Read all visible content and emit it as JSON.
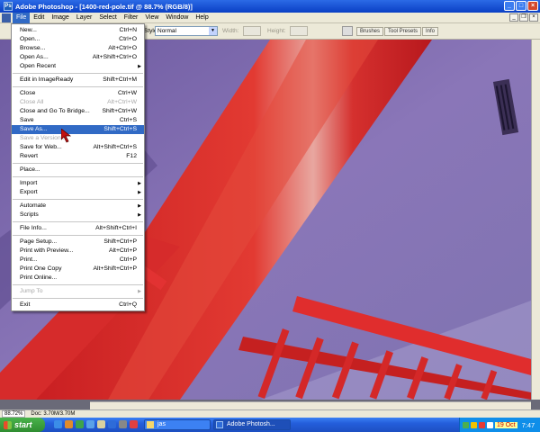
{
  "window": {
    "title": "Adobe Photoshop - [1400-red-pole.tif @ 88.7% (RGB/8)]",
    "buttons": {
      "minimize": "_",
      "maximize": "□",
      "close": "×"
    }
  },
  "menubar": {
    "items": [
      "File",
      "Edit",
      "Image",
      "Layer",
      "Select",
      "Filter",
      "View",
      "Window",
      "Help"
    ],
    "doc_buttons": {
      "minimize": "_",
      "restore": "❐",
      "close": "×"
    }
  },
  "options": {
    "style_label": "Style:",
    "style_value": "Normal",
    "width_label": "Width:",
    "height_label": "Height:",
    "palette_tabs": [
      "Brushes",
      "Tool Presets",
      "Info"
    ]
  },
  "file_menu": {
    "items": [
      {
        "label": "New...",
        "shortcut": "Ctrl+N",
        "disabled": false,
        "submenu": false
      },
      {
        "label": "Open...",
        "shortcut": "Ctrl+O",
        "disabled": false,
        "submenu": false
      },
      {
        "label": "Browse...",
        "shortcut": "Alt+Ctrl+O",
        "disabled": false,
        "submenu": false
      },
      {
        "label": "Open As...",
        "shortcut": "Alt+Shift+Ctrl+O",
        "disabled": false,
        "submenu": false
      },
      {
        "label": "Open Recent",
        "shortcut": "",
        "disabled": false,
        "submenu": true
      },
      {
        "separator": true
      },
      {
        "label": "Edit in ImageReady",
        "shortcut": "Shift+Ctrl+M",
        "disabled": false,
        "submenu": false
      },
      {
        "separator": true
      },
      {
        "label": "Close",
        "shortcut": "Ctrl+W",
        "disabled": false,
        "submenu": false
      },
      {
        "label": "Close All",
        "shortcut": "Alt+Ctrl+W",
        "disabled": true,
        "submenu": false
      },
      {
        "label": "Close and Go To Bridge...",
        "shortcut": "Shift+Ctrl+W",
        "disabled": false,
        "submenu": false
      },
      {
        "label": "Save",
        "shortcut": "Ctrl+S",
        "disabled": false,
        "submenu": false
      },
      {
        "label": "Save As...",
        "shortcut": "Shift+Ctrl+S",
        "disabled": false,
        "submenu": false,
        "highlighted": true
      },
      {
        "label": "Save a Version...",
        "shortcut": "",
        "disabled": true,
        "submenu": false
      },
      {
        "label": "Save for Web...",
        "shortcut": "Alt+Shift+Ctrl+S",
        "disabled": false,
        "submenu": false
      },
      {
        "label": "Revert",
        "shortcut": "F12",
        "disabled": false,
        "submenu": false
      },
      {
        "separator": true
      },
      {
        "label": "Place...",
        "shortcut": "",
        "disabled": false,
        "submenu": false
      },
      {
        "separator": true
      },
      {
        "label": "Import",
        "shortcut": "",
        "disabled": false,
        "submenu": true
      },
      {
        "label": "Export",
        "shortcut": "",
        "disabled": false,
        "submenu": true
      },
      {
        "separator": true
      },
      {
        "label": "Automate",
        "shortcut": "",
        "disabled": false,
        "submenu": true
      },
      {
        "label": "Scripts",
        "shortcut": "",
        "disabled": false,
        "submenu": true
      },
      {
        "separator": true
      },
      {
        "label": "File Info...",
        "shortcut": "Alt+Shift+Ctrl+I",
        "disabled": false,
        "submenu": false
      },
      {
        "separator": true
      },
      {
        "label": "Page Setup...",
        "shortcut": "Shift+Ctrl+P",
        "disabled": false,
        "submenu": false
      },
      {
        "label": "Print with Preview...",
        "shortcut": "Alt+Ctrl+P",
        "disabled": false,
        "submenu": false
      },
      {
        "label": "Print...",
        "shortcut": "Ctrl+P",
        "disabled": false,
        "submenu": false
      },
      {
        "label": "Print One Copy",
        "shortcut": "Alt+Shift+Ctrl+P",
        "disabled": false,
        "submenu": false
      },
      {
        "label": "Print Online...",
        "shortcut": "",
        "disabled": false,
        "submenu": false
      },
      {
        "separator": true
      },
      {
        "label": "Jump To",
        "shortcut": "",
        "disabled": true,
        "submenu": true
      },
      {
        "separator": true
      },
      {
        "label": "Exit",
        "shortcut": "Ctrl+Q",
        "disabled": false,
        "submenu": false
      }
    ]
  },
  "statusbar": {
    "zoom": "88.72%",
    "doc_info": "Doc: 3.70M/3.70M"
  },
  "taskbar": {
    "start_label": "start",
    "tasks": [
      {
        "label": "jas",
        "active": false
      },
      {
        "label": "Adobe Photosh...",
        "active": true
      }
    ],
    "date": "19 Oct",
    "time": "7:47"
  },
  "colors": {
    "highlight": "#316ac5",
    "pole_red": "#d8322f",
    "wall_purple": "#7c6aa6"
  }
}
